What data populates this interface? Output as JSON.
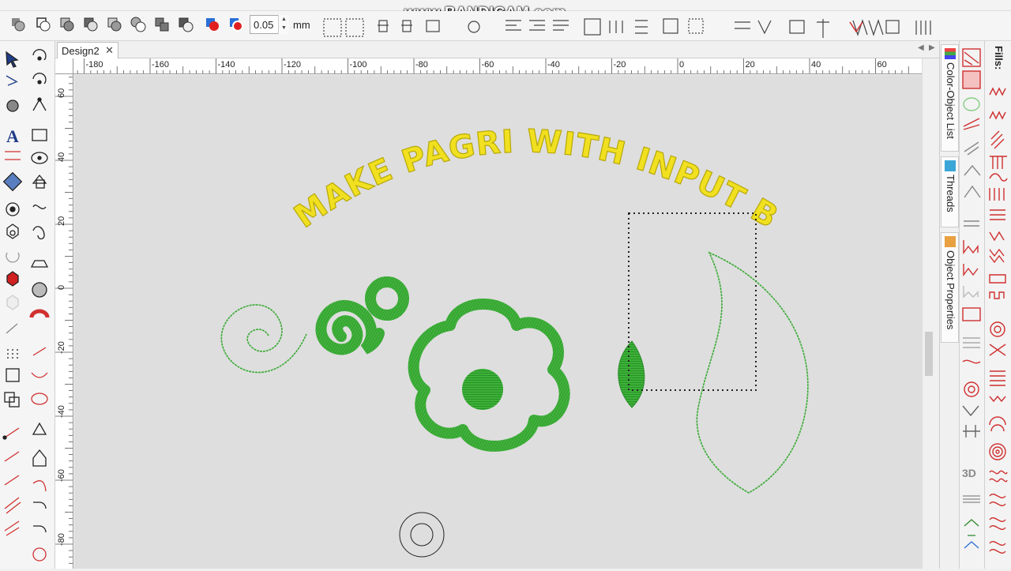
{
  "watermark": "www.BANDICAM.com",
  "toolbar": {
    "zoom_value": "0.05",
    "unit": "mm",
    "spin_up": "▲",
    "spin_down": "▼"
  },
  "tabs": {
    "active": "Design2",
    "close": "✕",
    "scroll_left": "◀",
    "scroll_right": "▶"
  },
  "rulers": {
    "horizontal": [
      "-180",
      "-160",
      "-140",
      "-120",
      "-100",
      "-80",
      "-60",
      "-40",
      "-20",
      "0",
      "20",
      "40",
      "60"
    ],
    "vertical": [
      "60",
      "40",
      "20",
      "0",
      "-20",
      "-40",
      "-60",
      "-80"
    ]
  },
  "dockers": {
    "color_object_list": "Color-Object List",
    "threads": "Threads",
    "object_properties": "Object Properties"
  },
  "panel": {
    "fills_label": "Fills:",
    "three_d": "3D"
  },
  "design": {
    "arc_text": "MAKE PAGRI WITH INPUT B",
    "text_color": "#f0e020",
    "green_color": "#3aaa35",
    "dark_green": "#2a8a2a"
  }
}
